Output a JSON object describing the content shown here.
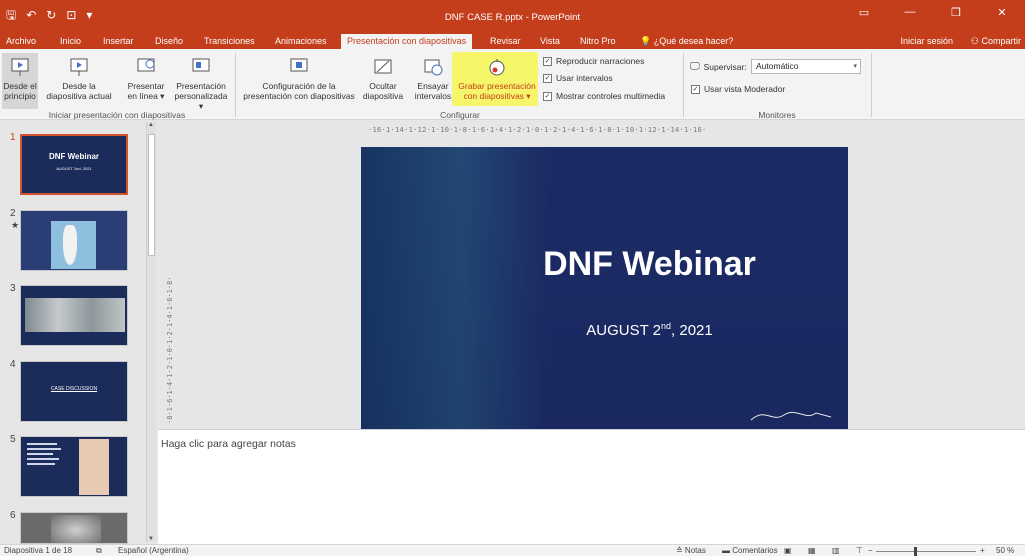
{
  "window": {
    "title": "DNF CASE R.pptx - PowerPoint",
    "controls": [
      "▭",
      "—",
      "❐",
      "✕"
    ]
  },
  "qat": {
    "save": "🖫",
    "undo": "↶",
    "redo": "↻",
    "present": "⊡",
    "more": "▾"
  },
  "tabs": [
    "Archivo",
    "Inicio",
    "Insertar",
    "Diseño",
    "Transiciones",
    "Animaciones",
    "Presentación con diapositivas",
    "Revisar",
    "Vista",
    "Nitro Pro",
    "¿Qué desea hacer?"
  ],
  "tabbar": {
    "signin": "Iniciar sesión",
    "share": "Compartir"
  },
  "ribbon": {
    "start_group": {
      "label": "Iniciar presentación con diapositivas",
      "from_start": [
        "Desde el",
        "principio"
      ],
      "from_current": [
        "Desde la",
        "diapositiva actual"
      ],
      "online": [
        "Presentar",
        "en línea ▾"
      ],
      "custom": [
        "Presentación",
        "personalizada ▾"
      ]
    },
    "setup_group": {
      "label": "Configurar",
      "config": [
        "Configuración de la",
        "presentación con diapositivas"
      ],
      "hide": [
        "Ocultar",
        "diapositiva"
      ],
      "rehearse": [
        "Ensayar",
        "intervalos"
      ],
      "record": [
        "Grabar presentación",
        "con diapositivas ▾"
      ],
      "checks": [
        "Reproducir narraciones",
        "Usar intervalos",
        "Mostrar controles multimedia"
      ]
    },
    "monitors_group": {
      "label": "Monitores",
      "monitor_label": "Supervisar:",
      "monitor_value": "Automático",
      "presenter_view": "Usar vista Moderador"
    }
  },
  "thumbnails": [
    {
      "num": "1",
      "title": "DNF Webinar",
      "subtitle": "AUGUST 2nd, 2021"
    },
    {
      "num": "2",
      "title": ""
    },
    {
      "num": "3",
      "title": ""
    },
    {
      "num": "4",
      "title": "CASE DISCUSSION"
    },
    {
      "num": "5",
      "title": ""
    },
    {
      "num": "6",
      "title": ""
    }
  ],
  "star": "★",
  "ruler": {
    "horizontal": "·16·1·14·1·12·1·10·1·8·1·6·1·4·1·2·1·0·1·2·1·4·1·6·1·8·1·10·1·12·1·14·1·16·",
    "vertical": "·8·1·6·1·4·1·2·1·0·1·2·1·4·1·6·1·8·"
  },
  "slide": {
    "title": "DNF Webinar",
    "date_main": "AUGUST 2",
    "date_sup": "nd",
    "date_rest": ", 2021"
  },
  "notes": {
    "placeholder": "Haga clic para agregar notas"
  },
  "status": {
    "slide_info": "Diapositiva 1 de 18",
    "language": "Español (Argentina)",
    "notes": "≙ Notas",
    "comments": "Comentarios",
    "zoom": "50 %",
    "minus": "−",
    "plus": "+"
  }
}
